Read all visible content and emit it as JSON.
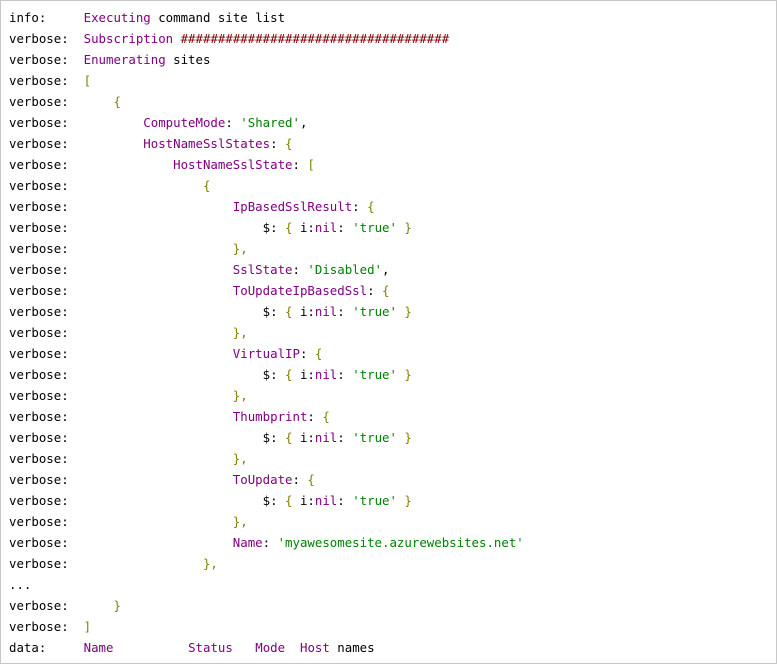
{
  "colors": {
    "text": "#000000",
    "keyword": "#800080",
    "string": "#008000",
    "punct": "#808000",
    "hash": "#800000",
    "background": "#ffffff"
  },
  "lines": [
    {
      "prefix": "info:",
      "segments": [
        {
          "text": "Executing",
          "c": "keyword"
        },
        {
          "text": " command site list",
          "c": "text"
        }
      ]
    },
    {
      "prefix": "verbose:",
      "segments": [
        {
          "text": "Subscription",
          "c": "keyword"
        },
        {
          "text": " ####################################",
          "c": "hash"
        }
      ]
    },
    {
      "prefix": "verbose:",
      "segments": [
        {
          "text": "Enumerating",
          "c": "keyword"
        },
        {
          "text": " sites",
          "c": "text"
        }
      ]
    },
    {
      "prefix": "verbose:",
      "segments": [
        {
          "text": "[",
          "c": "punct"
        }
      ]
    },
    {
      "prefix": "verbose:",
      "segments": [
        {
          "text": "    {",
          "c": "punct"
        }
      ]
    },
    {
      "prefix": "verbose:",
      "segments": [
        {
          "text": "        ComputeMode",
          "c": "keyword"
        },
        {
          "text": ": ",
          "c": "text"
        },
        {
          "text": "'Shared'",
          "c": "string"
        },
        {
          "text": ",",
          "c": "text"
        }
      ]
    },
    {
      "prefix": "verbose:",
      "segments": [
        {
          "text": "        HostNameSslStates",
          "c": "keyword"
        },
        {
          "text": ": ",
          "c": "text"
        },
        {
          "text": "{",
          "c": "punct"
        }
      ]
    },
    {
      "prefix": "verbose:",
      "segments": [
        {
          "text": "            HostNameSslState",
          "c": "keyword"
        },
        {
          "text": ": ",
          "c": "text"
        },
        {
          "text": "[",
          "c": "punct"
        }
      ]
    },
    {
      "prefix": "verbose:",
      "segments": [
        {
          "text": "                {",
          "c": "punct"
        }
      ]
    },
    {
      "prefix": "verbose:",
      "segments": [
        {
          "text": "                    IpBasedSslResult",
          "c": "keyword"
        },
        {
          "text": ": ",
          "c": "text"
        },
        {
          "text": "{",
          "c": "punct"
        }
      ]
    },
    {
      "prefix": "verbose:",
      "segments": [
        {
          "text": "                        $: ",
          "c": "text"
        },
        {
          "text": "{",
          "c": "punct"
        },
        {
          "text": " i:",
          "c": "text"
        },
        {
          "text": "nil",
          "c": "keyword"
        },
        {
          "text": ": ",
          "c": "text"
        },
        {
          "text": "'true'",
          "c": "string"
        },
        {
          "text": " }",
          "c": "punct"
        }
      ]
    },
    {
      "prefix": "verbose:",
      "segments": [
        {
          "text": "                    },",
          "c": "punct"
        }
      ]
    },
    {
      "prefix": "verbose:",
      "segments": [
        {
          "text": "                    SslState",
          "c": "keyword"
        },
        {
          "text": ": ",
          "c": "text"
        },
        {
          "text": "'Disabled'",
          "c": "string"
        },
        {
          "text": ",",
          "c": "text"
        }
      ]
    },
    {
      "prefix": "verbose:",
      "segments": [
        {
          "text": "                    ToUpdateIpBasedSsl",
          "c": "keyword"
        },
        {
          "text": ": ",
          "c": "text"
        },
        {
          "text": "{",
          "c": "punct"
        }
      ]
    },
    {
      "prefix": "verbose:",
      "segments": [
        {
          "text": "                        $: ",
          "c": "text"
        },
        {
          "text": "{",
          "c": "punct"
        },
        {
          "text": " i:",
          "c": "text"
        },
        {
          "text": "nil",
          "c": "keyword"
        },
        {
          "text": ": ",
          "c": "text"
        },
        {
          "text": "'true'",
          "c": "string"
        },
        {
          "text": " }",
          "c": "punct"
        }
      ]
    },
    {
      "prefix": "verbose:",
      "segments": [
        {
          "text": "                    },",
          "c": "punct"
        }
      ]
    },
    {
      "prefix": "verbose:",
      "segments": [
        {
          "text": "                    VirtualIP",
          "c": "keyword"
        },
        {
          "text": ": ",
          "c": "text"
        },
        {
          "text": "{",
          "c": "punct"
        }
      ]
    },
    {
      "prefix": "verbose:",
      "segments": [
        {
          "text": "                        $: ",
          "c": "text"
        },
        {
          "text": "{",
          "c": "punct"
        },
        {
          "text": " i:",
          "c": "text"
        },
        {
          "text": "nil",
          "c": "keyword"
        },
        {
          "text": ": ",
          "c": "text"
        },
        {
          "text": "'true'",
          "c": "string"
        },
        {
          "text": " }",
          "c": "punct"
        }
      ]
    },
    {
      "prefix": "verbose:",
      "segments": [
        {
          "text": "                    },",
          "c": "punct"
        }
      ]
    },
    {
      "prefix": "verbose:",
      "segments": [
        {
          "text": "                    Thumbprint",
          "c": "keyword"
        },
        {
          "text": ": ",
          "c": "text"
        },
        {
          "text": "{",
          "c": "punct"
        }
      ]
    },
    {
      "prefix": "verbose:",
      "segments": [
        {
          "text": "                        $: ",
          "c": "text"
        },
        {
          "text": "{",
          "c": "punct"
        },
        {
          "text": " i:",
          "c": "text"
        },
        {
          "text": "nil",
          "c": "keyword"
        },
        {
          "text": ": ",
          "c": "text"
        },
        {
          "text": "'true'",
          "c": "string"
        },
        {
          "text": " }",
          "c": "punct"
        }
      ]
    },
    {
      "prefix": "verbose:",
      "segments": [
        {
          "text": "                    },",
          "c": "punct"
        }
      ]
    },
    {
      "prefix": "verbose:",
      "segments": [
        {
          "text": "                    ToUpdate",
          "c": "keyword"
        },
        {
          "text": ": ",
          "c": "text"
        },
        {
          "text": "{",
          "c": "punct"
        }
      ]
    },
    {
      "prefix": "verbose:",
      "segments": [
        {
          "text": "                        $: ",
          "c": "text"
        },
        {
          "text": "{",
          "c": "punct"
        },
        {
          "text": " i:",
          "c": "text"
        },
        {
          "text": "nil",
          "c": "keyword"
        },
        {
          "text": ": ",
          "c": "text"
        },
        {
          "text": "'true'",
          "c": "string"
        },
        {
          "text": " }",
          "c": "punct"
        }
      ]
    },
    {
      "prefix": "verbose:",
      "segments": [
        {
          "text": "                    },",
          "c": "punct"
        }
      ]
    },
    {
      "prefix": "verbose:",
      "segments": [
        {
          "text": "                    Name",
          "c": "keyword"
        },
        {
          "text": ": ",
          "c": "text"
        },
        {
          "text": "'myawesomesite.azurewebsites.net'",
          "c": "string"
        }
      ]
    },
    {
      "prefix": "verbose:",
      "segments": [
        {
          "text": "                },",
          "c": "punct"
        }
      ]
    },
    {
      "prefix": "...",
      "segments": []
    },
    {
      "prefix": "verbose:",
      "segments": [
        {
          "text": "    }",
          "c": "punct"
        }
      ]
    },
    {
      "prefix": "verbose:",
      "segments": [
        {
          "text": "]",
          "c": "punct"
        }
      ]
    },
    {
      "prefix": "data:",
      "segments": [
        {
          "text": "Name",
          "c": "keyword"
        },
        {
          "text": "          ",
          "c": "text"
        },
        {
          "text": "Status",
          "c": "keyword"
        },
        {
          "text": "   ",
          "c": "text"
        },
        {
          "text": "Mode",
          "c": "keyword"
        },
        {
          "text": "  ",
          "c": "text"
        },
        {
          "text": "Host",
          "c": "keyword"
        },
        {
          "text": " names",
          "c": "text"
        }
      ]
    }
  ]
}
